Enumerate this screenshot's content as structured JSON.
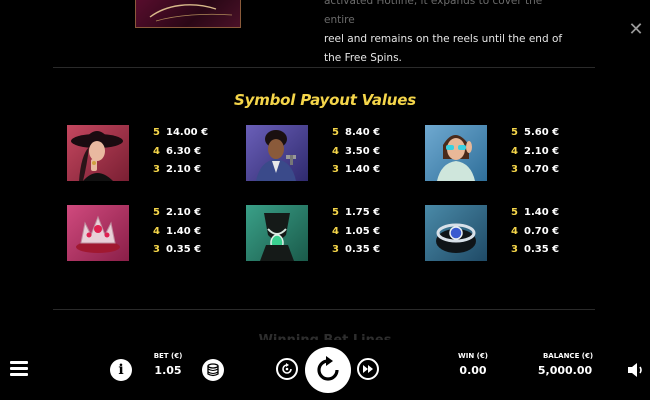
{
  "feature": {
    "line1": "activated Hotline, it expands to cover the entire",
    "line2": "reel and remains on the reels until the end of",
    "line3": "the Free Spins."
  },
  "section_title": "Symbol Payout Values",
  "symbols": [
    {
      "name": "woman-in-hat",
      "payouts": [
        {
          "count": "5",
          "value": "14.00 €"
        },
        {
          "count": "4",
          "value": "6.30 €"
        },
        {
          "count": "3",
          "value": "2.10 €"
        }
      ]
    },
    {
      "name": "man-with-gun",
      "payouts": [
        {
          "count": "5",
          "value": "8.40 €"
        },
        {
          "count": "4",
          "value": "3.50 €"
        },
        {
          "count": "3",
          "value": "1.40 €"
        }
      ]
    },
    {
      "name": "woman-with-sunglasses",
      "payouts": [
        {
          "count": "5",
          "value": "5.60 €"
        },
        {
          "count": "4",
          "value": "2.10 €"
        },
        {
          "count": "3",
          "value": "0.70 €"
        }
      ]
    },
    {
      "name": "tiara",
      "payouts": [
        {
          "count": "5",
          "value": "2.10 €"
        },
        {
          "count": "4",
          "value": "1.40 €"
        },
        {
          "count": "3",
          "value": "0.35 €"
        }
      ]
    },
    {
      "name": "necklace",
      "payouts": [
        {
          "count": "5",
          "value": "1.75 €"
        },
        {
          "count": "4",
          "value": "1.05 €"
        },
        {
          "count": "3",
          "value": "0.35 €"
        }
      ]
    },
    {
      "name": "bracelet",
      "payouts": [
        {
          "count": "5",
          "value": "1.40 €"
        },
        {
          "count": "4",
          "value": "0.70 €"
        },
        {
          "count": "3",
          "value": "0.35 €"
        }
      ]
    }
  ],
  "next_section_title": "Winning Bet Lines",
  "bottom_bar": {
    "bet_label": "BET (€)",
    "bet_value": "1.05",
    "win_label": "WIN (€)",
    "win_value": "0.00",
    "balance_label": "BALANCE (€)",
    "balance_value": "5,000.00",
    "info_label": "i"
  },
  "colors": {
    "accent_yellow": "#f4d54a",
    "background": "#000000"
  }
}
